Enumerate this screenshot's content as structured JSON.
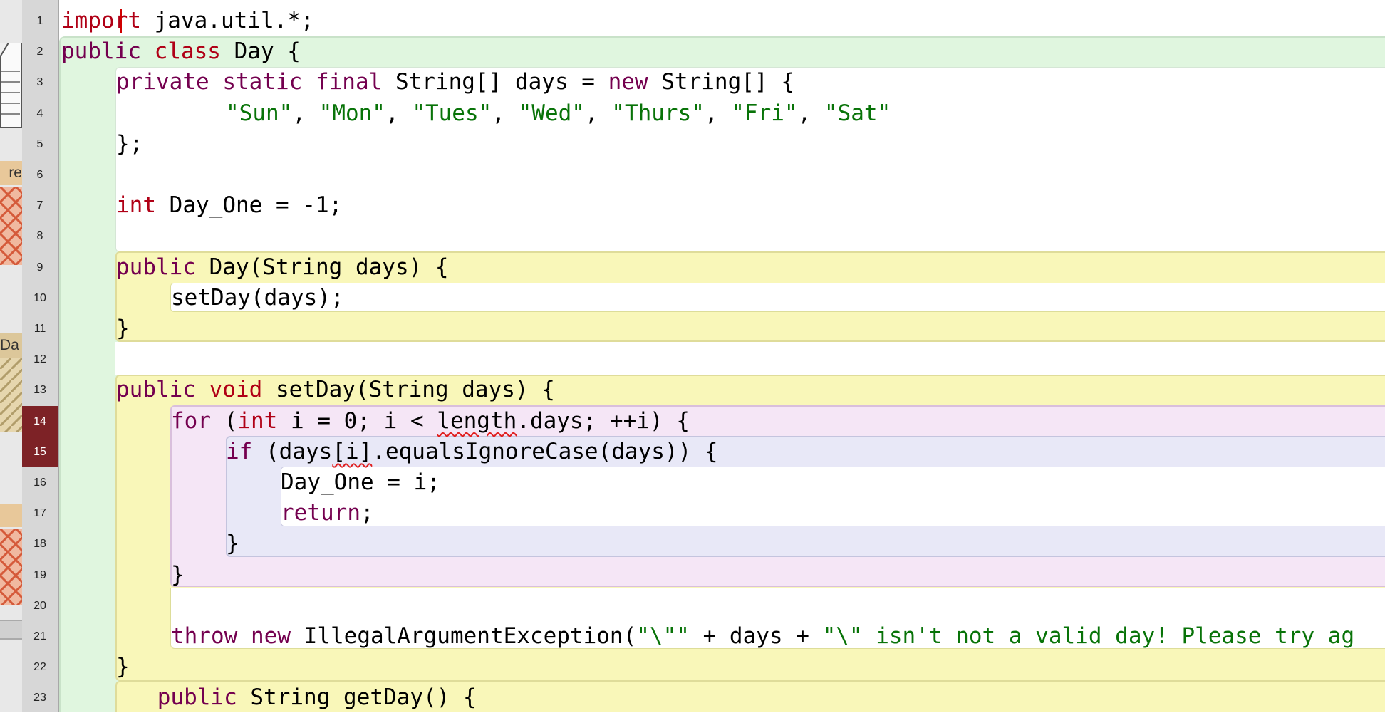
{
  "editor": {
    "line_numbers": [
      "1",
      "2",
      "3",
      "4",
      "5",
      "6",
      "7",
      "8",
      "9",
      "10",
      "11",
      "12",
      "13",
      "14",
      "15",
      "16",
      "17",
      "18",
      "19",
      "20",
      "21",
      "22",
      "23"
    ],
    "error_lines": [
      "14",
      "15"
    ],
    "lines": [
      [
        {
          "t": "import",
          "c": "kw"
        },
        {
          "t": " java.util.*;"
        }
      ],
      [
        {
          "t": "public",
          "c": "kw2"
        },
        {
          "t": " "
        },
        {
          "t": "class",
          "c": "kw"
        },
        {
          "t": " Day {"
        }
      ],
      [
        {
          "t": "private",
          "c": "kw2"
        },
        {
          "t": " "
        },
        {
          "t": "static",
          "c": "kw2"
        },
        {
          "t": " "
        },
        {
          "t": "final",
          "c": "kw2"
        },
        {
          "t": " String[] days = "
        },
        {
          "t": "new",
          "c": "kw2"
        },
        {
          "t": " String[] {"
        }
      ],
      [
        {
          "t": "\"Sun\"",
          "c": "str"
        },
        {
          "t": ", "
        },
        {
          "t": "\"Mon\"",
          "c": "str"
        },
        {
          "t": ", "
        },
        {
          "t": "\"Tues\"",
          "c": "str"
        },
        {
          "t": ", "
        },
        {
          "t": "\"Wed\"",
          "c": "str"
        },
        {
          "t": ", "
        },
        {
          "t": "\"Thurs\"",
          "c": "str"
        },
        {
          "t": ", "
        },
        {
          "t": "\"Fri\"",
          "c": "str"
        },
        {
          "t": ", "
        },
        {
          "t": "\"Sat\"",
          "c": "str"
        }
      ],
      [
        {
          "t": "};"
        }
      ],
      [],
      [
        {
          "t": "int",
          "c": "kw"
        },
        {
          "t": " Day_One = -1;"
        }
      ],
      [],
      [
        {
          "t": "public",
          "c": "kw2"
        },
        {
          "t": " Day(String days) {"
        }
      ],
      [
        {
          "t": "setDay(days);"
        }
      ],
      [
        {
          "t": "}"
        }
      ],
      [],
      [
        {
          "t": "public",
          "c": "kw2"
        },
        {
          "t": " "
        },
        {
          "t": "void",
          "c": "kw"
        },
        {
          "t": " setDay(String days) {"
        }
      ],
      [
        {
          "t": "for",
          "c": "kw2"
        },
        {
          "t": " ("
        },
        {
          "t": "int",
          "c": "kw"
        },
        {
          "t": " i = 0; i < "
        },
        {
          "t": "length",
          "c": "err-ul"
        },
        {
          "t": ".days; ++i) {"
        }
      ],
      [
        {
          "t": "if",
          "c": "kw2"
        },
        {
          "t": " (days"
        },
        {
          "t": "[i]",
          "c": "err-ul"
        },
        {
          "t": ".equalsIgnoreCase(days)) {"
        }
      ],
      [
        {
          "t": "Day_One = i;"
        }
      ],
      [
        {
          "t": "return",
          "c": "kw2"
        },
        {
          "t": ";"
        }
      ],
      [
        {
          "t": "}"
        }
      ],
      [
        {
          "t": "}"
        }
      ],
      [],
      [
        {
          "t": "throw",
          "c": "kw2"
        },
        {
          "t": " "
        },
        {
          "t": "new",
          "c": "kw2"
        },
        {
          "t": " IllegalArgumentException("
        },
        {
          "t": "\"\\\"\"",
          "c": "str"
        },
        {
          "t": " + days + "
        },
        {
          "t": "\"\\\" isn't not a valid day! Please try ag",
          "c": "str"
        }
      ],
      [
        {
          "t": "}"
        }
      ],
      [
        {
          "t": "public",
          "c": "kw2"
        },
        {
          "t": " String getDay() {"
        }
      ]
    ]
  },
  "left_window": {
    "label_1": "re",
    "label_2": "Da"
  }
}
